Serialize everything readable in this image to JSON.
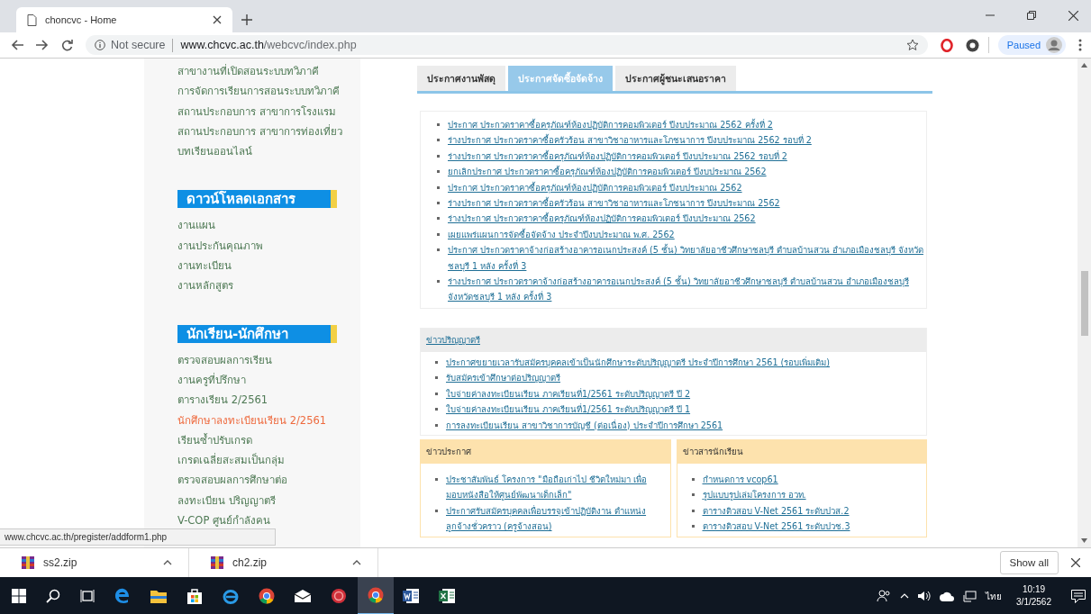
{
  "browser": {
    "tab_title": "choncvc - Home",
    "security": "Not secure",
    "url_host": "www.chcvc.ac.th",
    "url_path": "/webcvc/index.php",
    "profile_status": "Paused"
  },
  "sidebar": [
    {
      "items": [
        {
          "label": "สาขางานที่เปิดสอนระบบทวิภาคี",
          "selected": false
        },
        {
          "label": "การจัดการเรียนการสอนระบบทวิภาคี",
          "selected": false
        },
        {
          "label": "สถานประกอบการ สาขาการโรงแรม",
          "selected": false
        },
        {
          "label": "สถานประกอบการ สาขาการท่องเที่ยว",
          "selected": false
        },
        {
          "label": "บทเรียนออนไลน์",
          "selected": false
        }
      ]
    },
    {
      "heading": "ดาวน์โหลดเอกสาร",
      "items": [
        {
          "label": "งานแผน",
          "selected": false
        },
        {
          "label": "งานประกันคุณภาพ",
          "selected": false
        },
        {
          "label": "งานทะเบียน",
          "selected": false
        },
        {
          "label": "งานหลักสูตร",
          "selected": false
        }
      ]
    },
    {
      "heading": "นักเรียน-นักศึกษา",
      "items": [
        {
          "label": "ตรวจสอบผลการเรียน",
          "selected": false
        },
        {
          "label": "งานครูที่ปรึกษา",
          "selected": false
        },
        {
          "label": "ตารางเรียน 2/2561",
          "selected": false
        },
        {
          "label": "นักศึกษาลงทะเบียนเรียน 2/2561",
          "selected": true
        },
        {
          "label": "เรียนซ้ำปรับเกรด",
          "selected": false
        },
        {
          "label": "เกรดเฉลี่ยสะสมเป็นกลุ่ม",
          "selected": false
        },
        {
          "label": "ตรวจสอบผลการศึกษาต่อ",
          "selected": false
        },
        {
          "label": "ลงทะเบียน ปริญญาตรี",
          "selected": false
        },
        {
          "label": "V-COP ศูนย์กำลังคน",
          "selected": false
        }
      ]
    }
  ],
  "tabs": [
    {
      "label": "ประกาศงานพัสดุ",
      "selected": false
    },
    {
      "label": "ประกาศจัดซื้อจัดจ้าง",
      "selected": true
    },
    {
      "label": "ประกาศผู้ชนะเสนอราคา",
      "selected": false
    }
  ],
  "procurement_links": [
    "ประกาศ ประกวดราคาซื้อครุภัณฑ์ห้องปฏิบัติการคอมพิวเตอร์ ปีงบประมาณ 2562 ครั้งที่ 2",
    "ร่างประกาศ ประกวดราคาซื้อครัวร้อน สาขาวิชาอาหารและโภชนาการ ปีงบประมาณ 2562 รอบที่ 2",
    "ร่างประกาศ ประกวดราคาซื้อครุภัณฑ์ห้องปฏิบัติการคอมพิวเตอร์ ปีงบประมาณ 2562 รอบที่ 2",
    "ยกเลิกประกาศ ประกวดราคาซื้อครุภัณฑ์ห้องปฏิบัติการคอมพิวเตอร์ ปีงบประมาณ 2562",
    "ประกาศ ประกวดราคาซื้อครุภัณฑ์ห้องปฏิบัติการคอมพิวเตอร์ ปีงบประมาณ 2562",
    "ร่างประกาศ ประกวดราคาซื้อครัวร้อน สาขาวิชาอาหารและโภชนาการ ปีงบประมาณ 2562",
    "ร่างประกาศ ประกวดราคาซื้อครุภัณฑ์ห้องปฏิบัติการคอมพิวเตอร์ ปีงบประมาณ 2562",
    "เผยแพร่แผนการจัดซื้อจัดจ้าง ประจำปีงบประมาณ พ.ศ. 2562",
    "ประกาศ ประกวดราคาจ้างก่อสร้างอาคารอเนกประสงค์ (5 ชั้น) วิทยาลัยอาชีวศึกษาชลบุรี ตำบลบ้านสวน อำเภอเมืองชลบุรี จังหวัดชลบุรี 1 หลัง ครั้งที่ 3",
    "ร่างประกาศ ประกวดราคาจ้างก่อสร้างอาคารอเนกประสงค์ (5 ชั้น) วิทยาลัยอาชีวศึกษาชลบุรี ตำบลบ้านสวน อำเภอเมืองชลบุรี จังหวัดชลบุรี 1 หลัง ครั้งที่ 3"
  ],
  "degree_news": {
    "title": "ข่าวปริญญาตรี",
    "items": [
      "ประกาศขยายเวลารับสมัครบุคคลเข้าเป็นนักศึกษาระดับปริญญาตรี ประจำปีการศึกษา 2561 (รอบเพิ่มเติม)",
      "รับสมัครเข้าศึกษาต่อปริญญาตรี",
      "ใบจ่ายค่าลงทะเบียนเรียน ภาคเรียนที่1/2561 ระดับปริญญาตรี ปี 2",
      "ใบจ่ายค่าลงทะเบียนเรียน ภาคเรียนที่1/2561 ระดับปริญญาตรี ปี 1",
      "การลงทะเบียนเรียน สาขาวิชาการบัญชี (ต่อเนื่อง) ประจำปีการศึกษา 2561"
    ]
  },
  "news_panels": [
    {
      "title": "ข่าวประกาศ",
      "items": [
        "ประชาสัมพันธ์ โครงการ \"มือถือเก่าไป ชีวิตใหม่มา เพื่อมอบหนังสือให้ศูนย์พัฒนาเด็กเล็ก\"",
        "ประกาศรับสมัครบุคคลเพื่อบรรจุเข้าปฏิบัติงาน ตำแหน่ง ลูกจ้างชั่วคราว (ครูจ้างสอน)"
      ]
    },
    {
      "title": "ข่าวสารนักเรียน",
      "items": [
        "กำหนดการ vcop61",
        "รูปแบบรูปเล่มโครงการ อวท.",
        "ตารางติวสอบ V-Net 2561 ระดับปวส.2",
        "ตารางติวสอบ V-Net 2561 ระดับปวช.3"
      ]
    }
  ],
  "status_url": "www.chcvc.ac.th/pregister/addform1.php",
  "downloads": [
    {
      "name": "ss2.zip"
    },
    {
      "name": "ch2.zip"
    }
  ],
  "show_all": "Show all",
  "taskbar": {
    "language": "ไทย",
    "time": "10:19",
    "date": "3/1/2562"
  }
}
